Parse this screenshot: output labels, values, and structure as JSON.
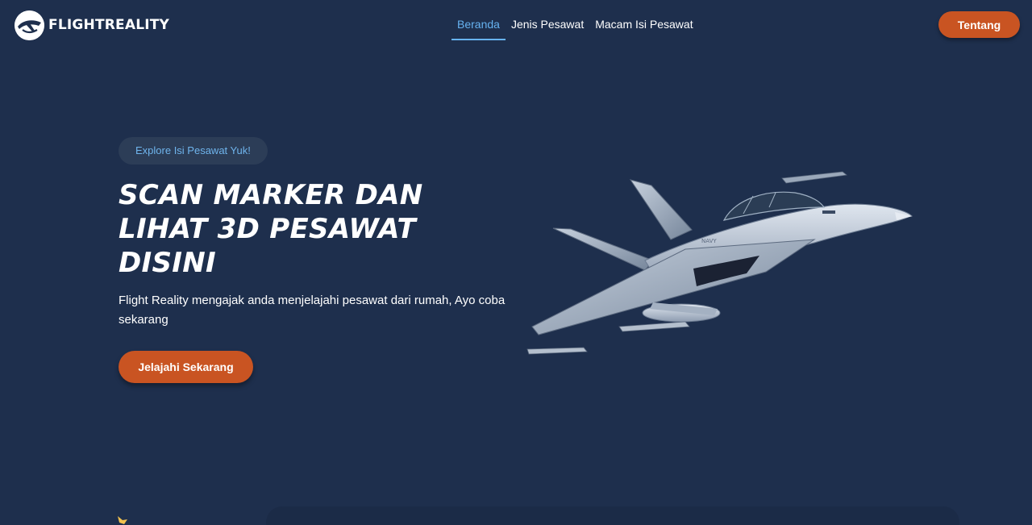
{
  "brand": {
    "name": "FLIGHTREALITY",
    "icon": "plane-logo-icon"
  },
  "nav": {
    "links": [
      {
        "label": "Beranda",
        "active": true
      },
      {
        "label": "Jenis Pesawat",
        "active": false
      },
      {
        "label": "Macam Isi Pesawat",
        "active": false
      }
    ],
    "cta_label": "Tentang"
  },
  "hero": {
    "pill": "Explore Isi Pesawat Yuk!",
    "title": "SCAN MARKER DAN LIHAT 3D PESAWAT DISINI",
    "description": "Flight Reality mengajak anda menjelajahi pesawat dari rumah, Ayo coba sekarang",
    "button_label": "Jelajahi Sekarang"
  },
  "colors": {
    "background": "#1e2f4d",
    "accent": "#c95422",
    "active_link": "#66b2f0"
  }
}
